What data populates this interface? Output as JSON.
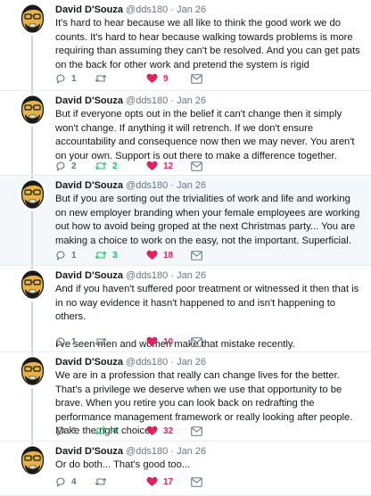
{
  "author": {
    "name": "David D'Souza",
    "handle": "@dds180",
    "separator": "·",
    "date": "Jan 26"
  },
  "tweets": [
    {
      "text": [
        "It's hard to hear because we all like to think the good work we do counts. It's hard to hear because walking towards problems is more requiring than assuming they can't be resolved. And you can get pats on the back for other work and pretend the system is rigid"
      ],
      "replies": "1",
      "retweets": "",
      "likes": "9",
      "highlighted": false
    },
    {
      "text": [
        "But if everyone opts out in the belief it can't change then it simply won't change. If anything it will retrench. If we don't ensure accountability and consequence now then we may never. You aren't on your own. Support is out there to make a difference together."
      ],
      "replies": "2",
      "retweets": "2",
      "likes": "12",
      "highlighted": false
    },
    {
      "text": [
        "But if you are sorting out the trivialities of work and life and working on new employer branding when your female employees are working out how to avoid being groped at the next Christmas party... You are making a choice to work on the easy, not the important. Superficial."
      ],
      "replies": "1",
      "retweets": "3",
      "likes": "18",
      "highlighted": true
    },
    {
      "text": [
        "And if you haven't suffered poor treatment or witnessed it then that is in no way evidence it hasn't happened to and isn't happening to others.",
        "I've seen men and women make that mistake recently."
      ],
      "replies": "1",
      "retweets": "",
      "likes": "10",
      "highlighted": false
    },
    {
      "text": [
        "We are in a profession that really can change lives for the better. That's a privilege we deserve when we use that opportunity to be brave. When you retire you can look back on redrafting the performance management framework or really looking after people. Make the right choice."
      ],
      "replies": "3",
      "retweets": "4",
      "likes": "32",
      "highlighted": false
    },
    {
      "text": [
        "Or do both... That's good too..."
      ],
      "replies": "4",
      "retweets": "",
      "likes": "17",
      "highlighted": false
    }
  ],
  "icons": {
    "reply": "reply-icon",
    "retweet": "retweet-icon",
    "like": "heart-icon",
    "message": "envelope-icon"
  },
  "colors": {
    "like": "#e0245e",
    "retweet_active": "#17bf63",
    "muted": "#657786",
    "highlight_bg": "#f5f8fa",
    "thread_line": "#ccd6dd"
  }
}
